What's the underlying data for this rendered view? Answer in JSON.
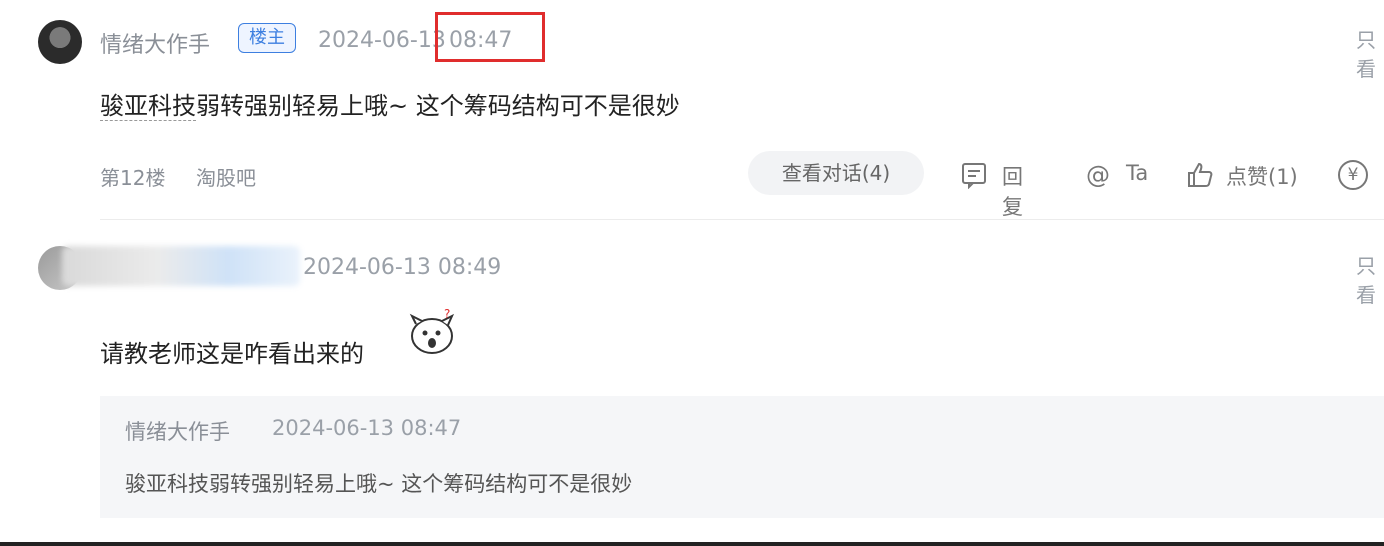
{
  "comment1": {
    "username": "情绪大作手",
    "badge": "楼主",
    "date": "2024-06-13",
    "time": "08:47",
    "text_underlined": "骏亚科技",
    "text_rest": "弱转强别轻易上哦~ 这个筹码结构可不是很妙",
    "floor": "第12楼",
    "source": "淘股吧",
    "view_dialog": "查看对话(4)",
    "reply": "回复",
    "at_ta": "Ta",
    "like": "点赞(1)",
    "reward_icon": "¥",
    "only_see": "只看"
  },
  "comment2": {
    "datetime": "2024-06-13 08:49",
    "text": "请教老师这是咋看出来的",
    "only_see": "只看",
    "quote": {
      "username": "情绪大作手",
      "datetime": "2024-06-13 08:47",
      "text": "骏亚科技弱转强别轻易上哦~ 这个筹码结构可不是很妙"
    }
  },
  "colors": {
    "highlight": "#e02d2d",
    "badge": "#3d7fe0"
  }
}
